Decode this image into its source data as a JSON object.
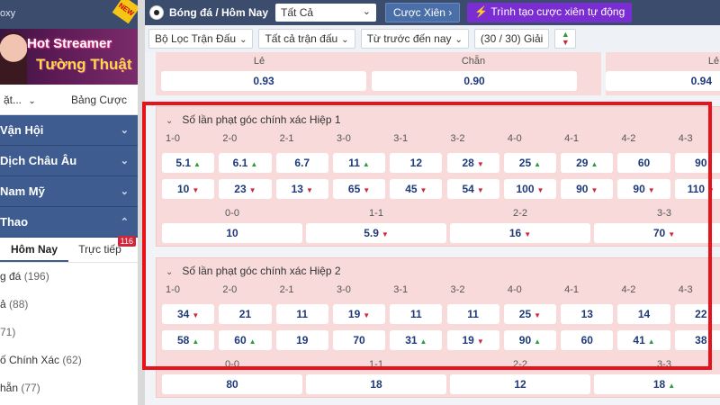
{
  "sidebar": {
    "logo_fragment": "oxy",
    "new_badge": "NEW",
    "banner": {
      "line1": "Hot Streamer",
      "line2": "Tường Thuật"
    },
    "tabs": [
      {
        "label": "ặt..."
      },
      {
        "label": "Bảng Cược"
      }
    ],
    "groups": [
      {
        "label": "Vận Hội"
      },
      {
        "label": "Dịch Châu Âu"
      },
      {
        "label": "Nam Mỹ"
      },
      {
        "label": "Thao"
      }
    ],
    "subtabs": {
      "active": "Hôm Nay",
      "live": "Trực tiếp",
      "live_count": "116"
    },
    "leagues": [
      {
        "label": "g đá",
        "count": "(196)"
      },
      {
        "label": "ả",
        "count": "(88)"
      },
      {
        "label": "",
        "count": "71)"
      },
      {
        "label": "ố Chính Xác",
        "count": "(62)"
      },
      {
        "label": "hẵn",
        "count": "(77)"
      }
    ]
  },
  "topbar": {
    "title": "Bóng đá / Hôm Nay",
    "select_value": "Tất Cả",
    "parlay_button": "Cược Xiên",
    "auto_button": "Trình tạo cược xiên tự động"
  },
  "filters": {
    "league_filter": "Bộ Lọc Trận Đấu",
    "match_filter": "Tất cả trận đấu",
    "time_filter": "Từ trước đến nay",
    "count": "(30 / 30) Giải"
  },
  "top_markets": {
    "left": {
      "odd_label": "Lẻ",
      "odd_value": "0.93",
      "even_label": "Chẵn",
      "even_value": "0.90"
    },
    "right": {
      "odd_label": "Lẻ",
      "odd_value": "0.94"
    }
  },
  "markets": [
    {
      "title": "Số lần phạt góc chính xác Hiệp 1",
      "scores": [
        "1-0",
        "2-0",
        "2-1",
        "3-0",
        "3-1",
        "3-2",
        "4-0",
        "4-1",
        "4-2",
        "4-3"
      ],
      "row1": [
        {
          "v": "5.1",
          "t": "up"
        },
        {
          "v": "6.1",
          "t": "up"
        },
        {
          "v": "6.7",
          "t": ""
        },
        {
          "v": "11",
          "t": "up"
        },
        {
          "v": "12",
          "t": ""
        },
        {
          "v": "28",
          "t": "dn"
        },
        {
          "v": "25",
          "t": "up"
        },
        {
          "v": "29",
          "t": "up"
        },
        {
          "v": "60",
          "t": ""
        },
        {
          "v": "90",
          "t": ""
        }
      ],
      "row2": [
        {
          "v": "10",
          "t": "dn"
        },
        {
          "v": "23",
          "t": "dn"
        },
        {
          "v": "13",
          "t": "dn"
        },
        {
          "v": "65",
          "t": "dn"
        },
        {
          "v": "45",
          "t": "dn"
        },
        {
          "v": "54",
          "t": "dn"
        },
        {
          "v": "100",
          "t": "dn"
        },
        {
          "v": "90",
          "t": "dn"
        },
        {
          "v": "90",
          "t": "dn"
        },
        {
          "v": "110",
          "t": "dn"
        }
      ],
      "draws": [
        "0-0",
        "1-1",
        "2-2",
        "3-3"
      ],
      "draw_vals": [
        {
          "v": "10",
          "t": ""
        },
        {
          "v": "5.9",
          "t": "dn"
        },
        {
          "v": "16",
          "t": "dn"
        },
        {
          "v": "70",
          "t": "dn"
        }
      ]
    },
    {
      "title": "Số lần phạt góc chính xác Hiệp 2",
      "scores": [
        "1-0",
        "2-0",
        "2-1",
        "3-0",
        "3-1",
        "3-2",
        "4-0",
        "4-1",
        "4-2",
        "4-3"
      ],
      "row1": [
        {
          "v": "34",
          "t": "dn"
        },
        {
          "v": "21",
          "t": ""
        },
        {
          "v": "11",
          "t": ""
        },
        {
          "v": "19",
          "t": "dn"
        },
        {
          "v": "11",
          "t": ""
        },
        {
          "v": "11",
          "t": ""
        },
        {
          "v": "25",
          "t": "dn"
        },
        {
          "v": "13",
          "t": ""
        },
        {
          "v": "14",
          "t": ""
        },
        {
          "v": "22",
          "t": ""
        }
      ],
      "row2": [
        {
          "v": "58",
          "t": "up"
        },
        {
          "v": "60",
          "t": "up"
        },
        {
          "v": "19",
          "t": ""
        },
        {
          "v": "70",
          "t": ""
        },
        {
          "v": "31",
          "t": "up"
        },
        {
          "v": "19",
          "t": "dn"
        },
        {
          "v": "90",
          "t": "up"
        },
        {
          "v": "60",
          "t": ""
        },
        {
          "v": "41",
          "t": "up"
        },
        {
          "v": "38",
          "t": ""
        }
      ],
      "draws": [
        "0-0",
        "1-1",
        "2-2",
        "3-3"
      ],
      "draw_vals": [
        {
          "v": "80",
          "t": ""
        },
        {
          "v": "18",
          "t": ""
        },
        {
          "v": "12",
          "t": ""
        },
        {
          "v": "18",
          "t": "up"
        }
      ]
    }
  ]
}
